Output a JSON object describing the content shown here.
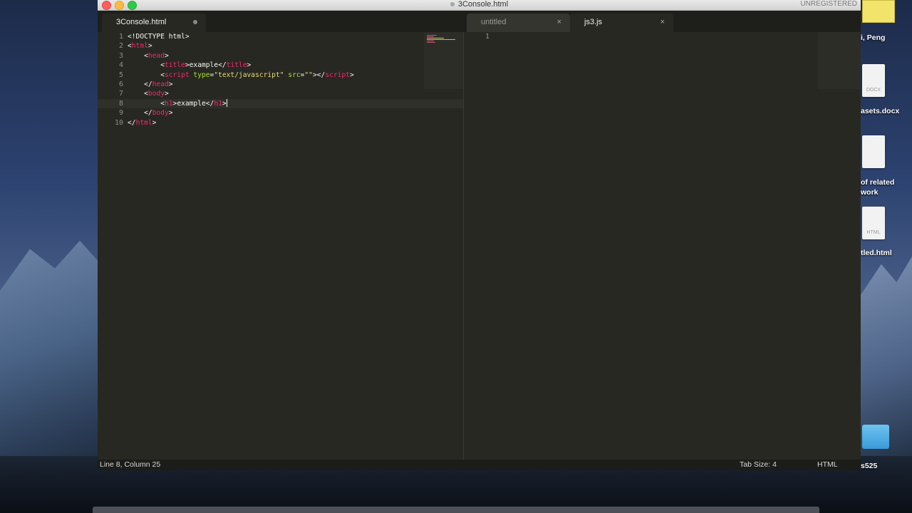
{
  "window": {
    "title": "3Console.html",
    "unregistered": "UNREGISTERED"
  },
  "tabs": {
    "left": [
      {
        "label": "3Console.html",
        "active": true,
        "dirty": true
      }
    ],
    "right": [
      {
        "label": "untitled",
        "active": false
      },
      {
        "label": "js3.js",
        "active": true
      }
    ],
    "close_glyph": "×"
  },
  "editor_left": {
    "line_numbers": [
      "1",
      "2",
      "3",
      "4",
      "5",
      "6",
      "7",
      "8",
      "9",
      "10"
    ],
    "current_line": 8
  },
  "editor_right": {
    "line_numbers": [
      "1"
    ]
  },
  "status": {
    "position": "Line 8, Column 25",
    "tab_size": "Tab Size: 4",
    "syntax": "HTML"
  },
  "desktop": {
    "items": [
      {
        "label": "i, Peng"
      },
      {
        "label": "asets.docx",
        "doc_type": "DOCX"
      },
      {
        "label": "of related work"
      },
      {
        "label": "tled.html",
        "doc_type": "HTML"
      },
      {
        "label": "s525"
      }
    ]
  },
  "colors": {
    "editor_bg": "#272822",
    "tag": "#f92672",
    "attr": "#a6e22e",
    "string": "#e6db74",
    "text": "#f8f8f2"
  }
}
